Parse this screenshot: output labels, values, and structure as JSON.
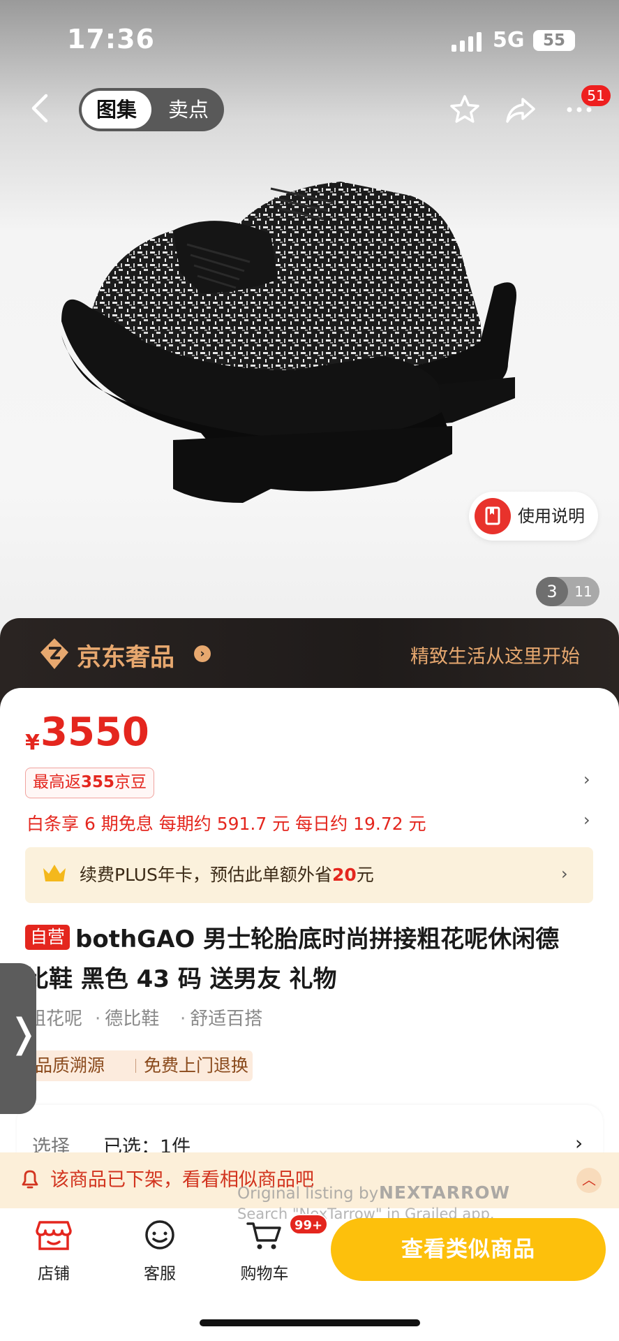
{
  "status_bar": {
    "time": "17:36",
    "network": "5G",
    "battery": "55"
  },
  "header": {
    "tabs": [
      {
        "label": "图集",
        "active": true
      },
      {
        "label": "卖点",
        "active": false
      }
    ],
    "more_badge": "51"
  },
  "gallery": {
    "manual_label": "使用说明",
    "page_current": "3",
    "page_total": "11"
  },
  "lux_banner": {
    "name": "京东奢品",
    "arrow": "›",
    "slogan": "精致生活从这里开始"
  },
  "price": {
    "currency": "¥",
    "amount": "3550"
  },
  "bean_tag": {
    "prefix": "最高返",
    "amount": "355",
    "suffix": "京豆"
  },
  "baitiao_text": "白条享 6 期免息  每期约 591.7 元  每日约 19.72 元",
  "plus_card": {
    "text_before": "续费PLUS年卡，预估此单额外省",
    "highlight": "20",
    "text_after": "元"
  },
  "product": {
    "self_tag": "自营",
    "title_line1": "bothGAO 男士轮胎底时尚拼接粗花呢休闲德",
    "title_line2": "比鞋 黑色 43 码 送男友 礼物",
    "features": [
      "粗花呢",
      "德比鞋",
      "舒适百搭"
    ],
    "feature_dot": "·",
    "services": [
      "品质溯源",
      "免费上门退换"
    ]
  },
  "edge_tab_symbol": "❭",
  "chevron": "›",
  "choose": {
    "label": "选择",
    "value": "已选：1件"
  },
  "notice": {
    "text": "该商品已下架，看看相似商品吧",
    "toggle": "︿"
  },
  "watermark": {
    "line1": "Original listing by",
    "logo": "NEXTARROW",
    "line2": "Search \"NexTarrow\" in Grailed app."
  },
  "bottom_bar": {
    "store_label": "店铺",
    "service_label": "客服",
    "cart_label": "购物车",
    "cart_badge": "99+",
    "cta_label": "查看类似商品"
  },
  "colors": {
    "jd_red": "#e4261e",
    "gold": "#e7a86f",
    "cta_yellow": "#fdc00c"
  }
}
